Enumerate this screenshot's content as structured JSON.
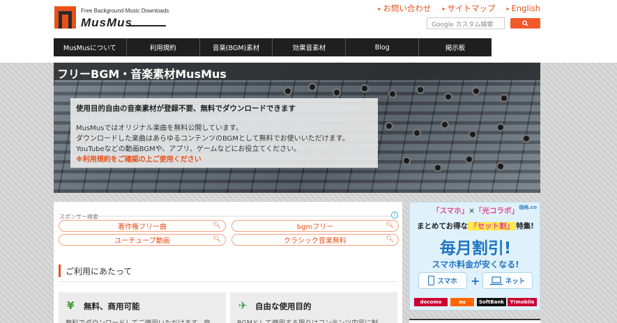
{
  "header": {
    "logo_tagline": "Free Background Music Downloads",
    "logo_name": "MusMus",
    "links": [
      {
        "label": "お問い合わせ"
      },
      {
        "label": "サイトマップ"
      },
      {
        "label": "English"
      }
    ],
    "search": {
      "placeholder": "Google カスタム検索",
      "button_icon": "search-icon"
    }
  },
  "nav": {
    "items": [
      {
        "label": "MusMusについて"
      },
      {
        "label": "利用規約"
      },
      {
        "label": "音楽(BGM)素材"
      },
      {
        "label": "効果音素材"
      },
      {
        "label": "Blog"
      },
      {
        "label": "掲示板"
      }
    ]
  },
  "hero": {
    "title": "フリーBGM・音楽素材MusMus",
    "headline": "使用目的自由の音楽素材が登録不要、無料でダウンロードできます",
    "lines": [
      "MusMusではオリジナル楽曲を無料公開しています。",
      "ダウンロードした楽曲はあらゆるコンテンツのBGMとして無料でお使いいただけます。",
      "YouTubeなどの動画BGMや、アプリ、ゲームなどにお役立てください。"
    ],
    "warning": "※利用規約をご確認の上ご使用ください"
  },
  "sponsor": {
    "label": "スポンサー検索",
    "pills": [
      {
        "label": "著作権フリー曲"
      },
      {
        "label": "bgmフリー"
      },
      {
        "label": "ユーチューブ動画"
      },
      {
        "label": "クラシック音楽無料"
      }
    ]
  },
  "usage": {
    "section_title": "ご利用にあたって",
    "features": [
      {
        "icon": "yen-icon",
        "glyph": "¥",
        "title": "無料、商用可能",
        "desc": "無料でダウンロードしてご使用いただけます。商"
      },
      {
        "icon": "paper-plane-icon",
        "glyph": "✈",
        "title": "自由な使用目的",
        "desc": "BGMとして使用する限りはコンテンツ内容に制"
      }
    ]
  },
  "ad": {
    "badge": "価格.co",
    "top_a": "「スマホ」",
    "top_x": "×",
    "top_b": "「光コラボ」",
    "sub_a": "まとめてお得な",
    "sub_b": "「セット割」",
    "sub_c": "特集!",
    "big": "毎月割引!",
    "sub2": "スマホ料金が安くなる!",
    "opt_left": "スマホ",
    "opt_right": "ネット",
    "plus": "+",
    "carriers": [
      {
        "label": "docomo",
        "color": "#cc0033"
      },
      {
        "label": "au",
        "color": "#ff6600"
      },
      {
        "label": "SoftBank",
        "color": "#111111"
      },
      {
        "label": "Y!mobile",
        "color": "#cc0033"
      }
    ]
  },
  "colors": {
    "accent": "#e6511b",
    "nav_bg": "#1f1f1f",
    "ad_blue": "#1f74c2"
  }
}
